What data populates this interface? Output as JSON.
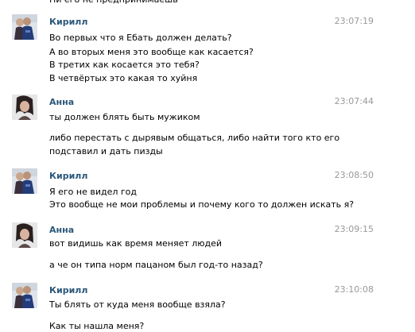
{
  "top_partial": "Ни его не предпринимаешь",
  "messages": [
    {
      "author": "Кирилл",
      "time": "23:07:19",
      "lines": [
        "Во первых что я Ебать должен делать?",
        "А во вторых меня это вообще как касается?",
        "В третих как косается это тебя?",
        "В четвёртых это какая то хуйня"
      ]
    },
    {
      "author": "Анна",
      "time": "23:07:44",
      "lines": [
        "ты должен блять быть мужиком",
        "либо перестать с дырявым общаться, либо найти того кто его",
        "подставил и дать пизды"
      ]
    },
    {
      "author": "Кирилл",
      "time": "23:08:50",
      "lines": [
        "Я его не видел год",
        "Это вообще не мои проблемы и почему кого то должен искать я?"
      ]
    },
    {
      "author": "Анна",
      "time": "23:09:15",
      "lines": [
        "вот видишь как время меняет людей",
        "а че он типа норм пацаном был год-то назад?"
      ]
    },
    {
      "author": "Кирилл",
      "time": "23:10:08",
      "lines": [
        "Ты блять от куда меня вообще взяла?",
        "Как ты нашла меня?"
      ]
    }
  ],
  "colors": {
    "author": "#2b587a",
    "time": "#999999",
    "text": "#000000"
  }
}
